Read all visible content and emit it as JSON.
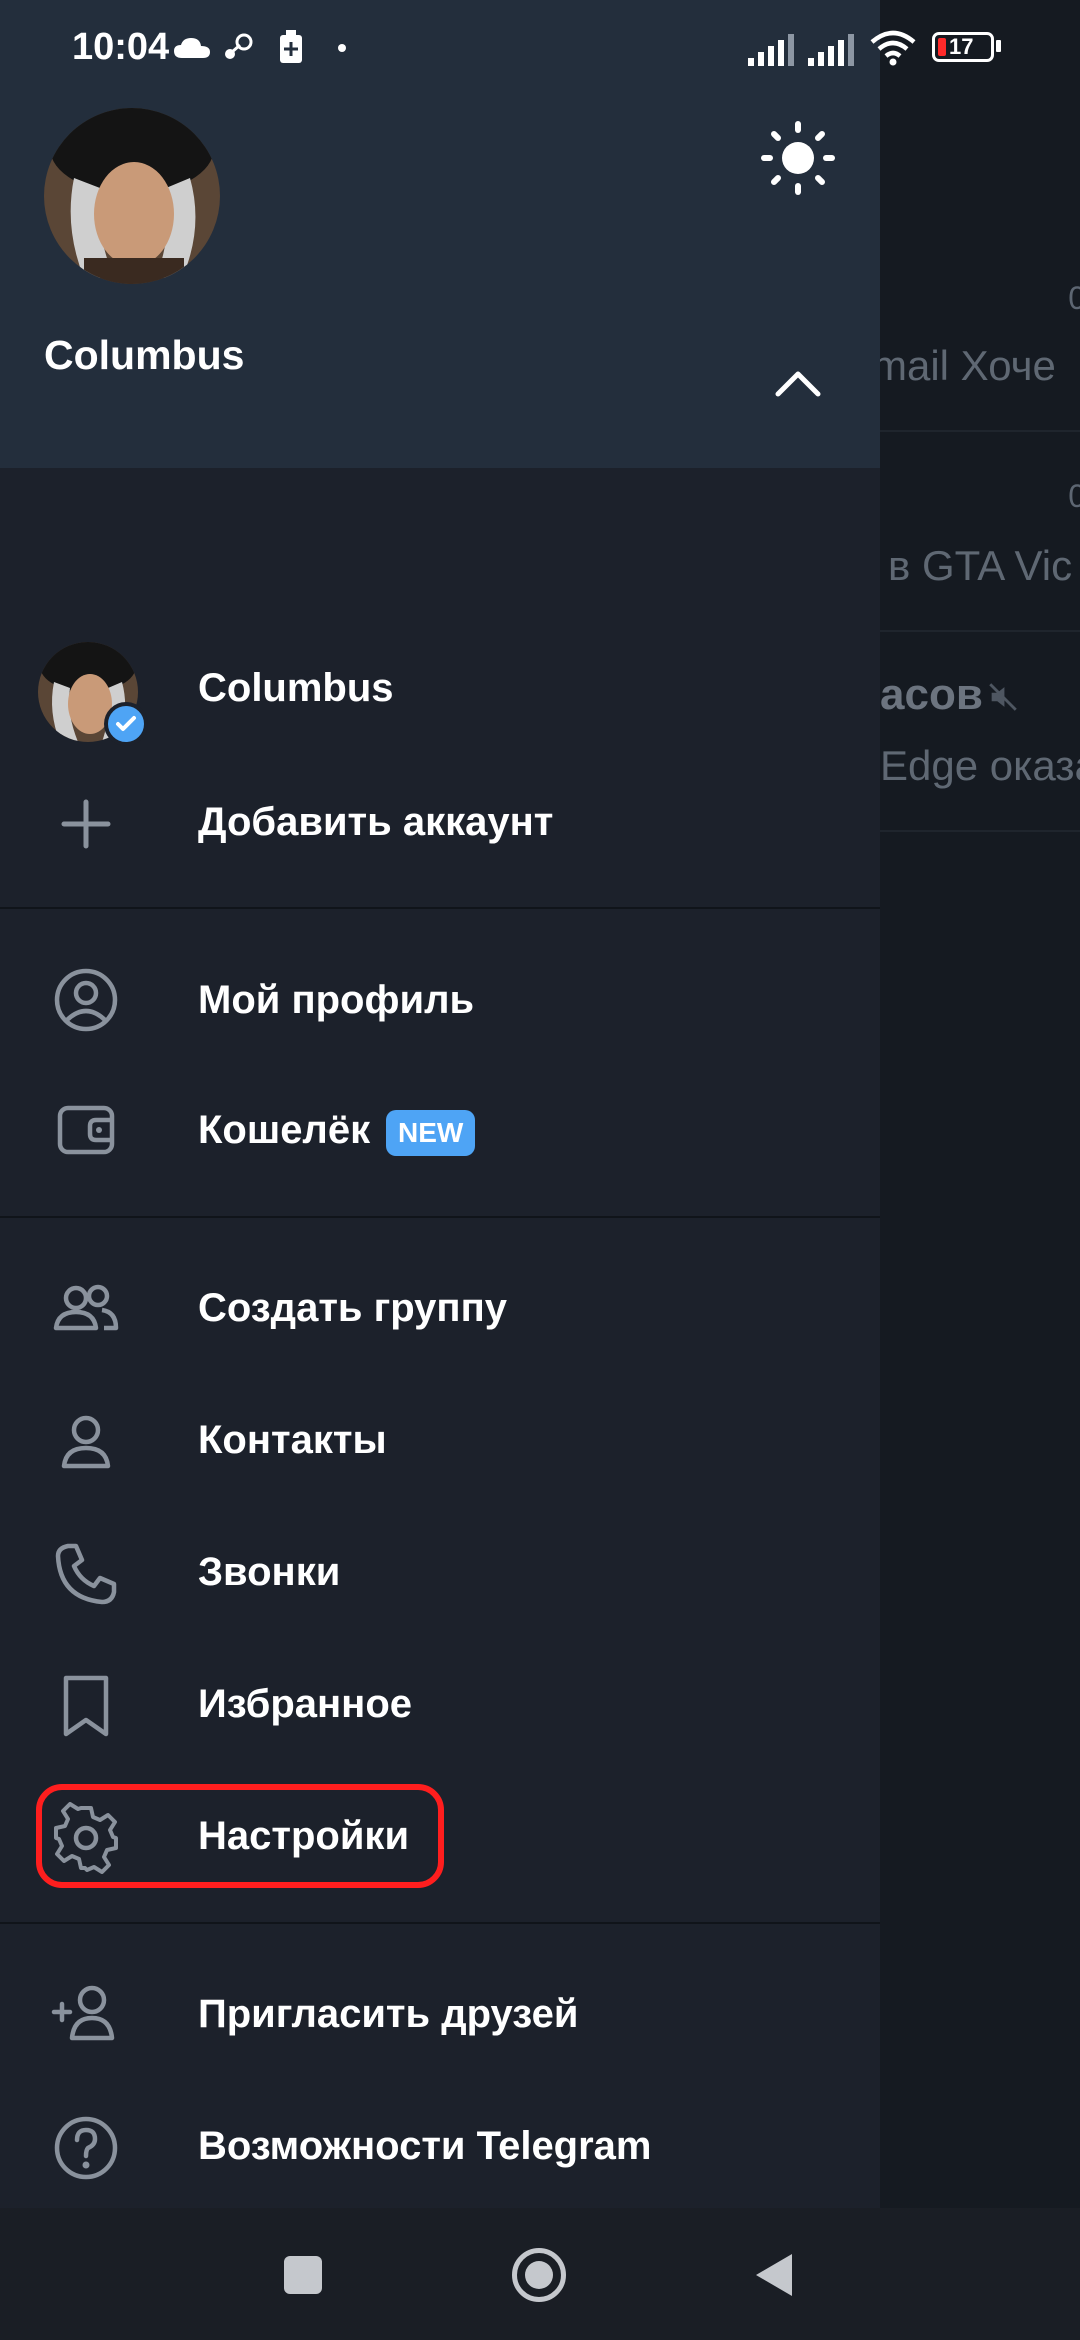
{
  "status_bar": {
    "time": "10:04",
    "battery": "17"
  },
  "background_chats": [
    {
      "time": "0",
      "preview": "mail  Хоче"
    },
    {
      "time": "0",
      "preview": "в GTA Vic"
    },
    {
      "title": "асов",
      "preview": "Edge оказа"
    }
  ],
  "header": {
    "name": "Columbus",
    "theme_toggle_icon": "sun-icon",
    "collapse_icon": "chevron-up-icon"
  },
  "accounts": {
    "current_name": "Columbus",
    "add_label": "Добавить аккаунт"
  },
  "menu": {
    "profile": "Мой профиль",
    "wallet": "Кошелёк",
    "wallet_badge": "NEW",
    "new_group": "Создать группу",
    "contacts": "Контакты",
    "calls": "Звонки",
    "saved": "Избранное",
    "settings": "Настройки",
    "invite": "Пригласить друзей",
    "features": "Возможности Telegram"
  },
  "colors": {
    "header_bg": "#232e3c",
    "drawer_bg": "#1c212b",
    "accent": "#4ea4f5",
    "highlight": "#ff1e1e"
  }
}
